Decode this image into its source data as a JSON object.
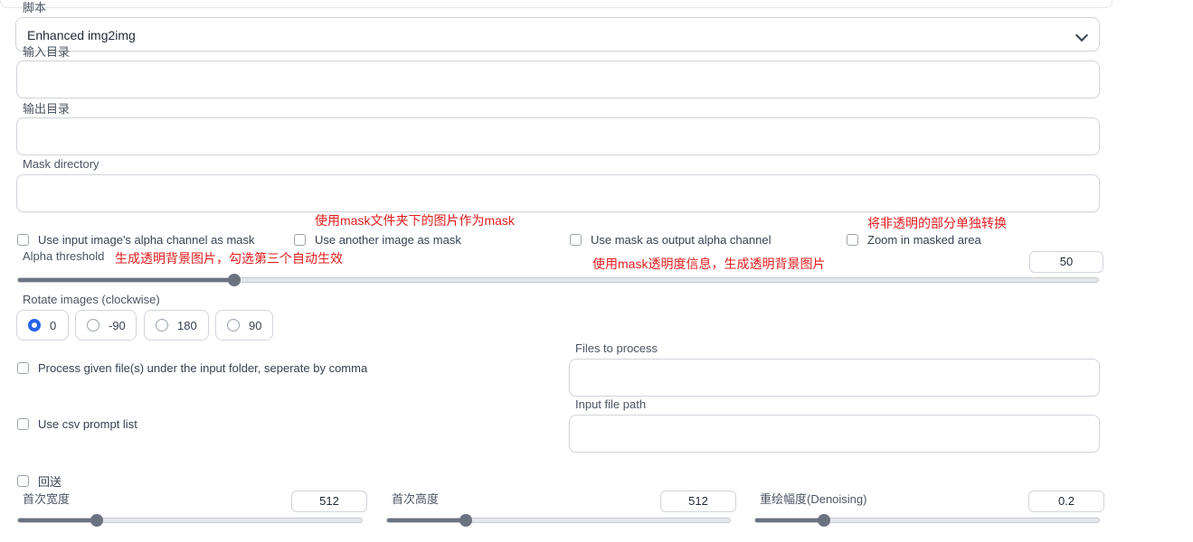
{
  "script_section": {
    "label": "脚本",
    "selected": "Enhanced img2img"
  },
  "fields": {
    "input_dir": {
      "label": "输入目录",
      "value": ""
    },
    "output_dir": {
      "label": "输出目录",
      "value": ""
    },
    "mask_dir": {
      "label": "Mask directory",
      "value": ""
    }
  },
  "checkboxes": {
    "alpha_mask": "Use input image's alpha channel as mask",
    "another_mask": "Use another image as mask",
    "mask_output_alpha": "Use mask as output alpha channel",
    "zoom_masked": "Zoom in masked area"
  },
  "annotations": {
    "another_mask_note": "使用mask文件夹下的图片作为mask",
    "zoom_note": "将非透明的部分单独转换",
    "alpha_threshold_note": "生成透明背景图片，勾选第三个自动生效",
    "mask_output_note": "使用mask透明度信息，生成透明背景图片"
  },
  "alpha_threshold": {
    "label": "Alpha threshold",
    "value": "50",
    "fraction": 0.2
  },
  "rotate": {
    "label": "Rotate images (clockwise)",
    "options": [
      "0",
      "-90",
      "180",
      "90"
    ],
    "selected": "0"
  },
  "process_files": {
    "checkbox_label": "Process given file(s) under the input folder, seperate by comma",
    "files_label": "Files to process",
    "files_value": ""
  },
  "csv": {
    "checkbox_label": "Use csv prompt list",
    "path_label": "Input file path",
    "path_value": ""
  },
  "feedback": {
    "label": "回送"
  },
  "sliders": [
    {
      "label": "首次宽度",
      "value": "512",
      "fraction": 0.23
    },
    {
      "label": "首次高度",
      "value": "512",
      "fraction": 0.23
    },
    {
      "label": "重绘幅度(Denoising)",
      "value": "0.2",
      "fraction": 0.2
    }
  ],
  "colors": {
    "annotation": "#e11d1d",
    "radio_selected": "#2563eb",
    "slider_fill": "#6b7280"
  }
}
